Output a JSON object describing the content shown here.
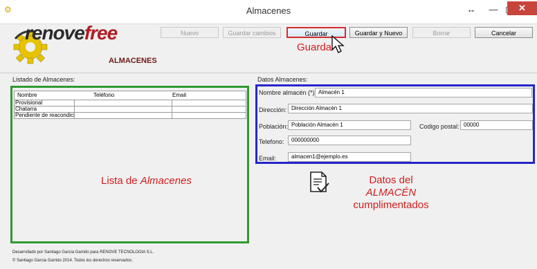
{
  "window": {
    "title": "Almacenes",
    "icon": "gear-icon",
    "controls": [
      "↔",
      "—",
      "▢",
      "✕"
    ]
  },
  "toolbar": {
    "nuevo": "Nuevo",
    "guardar_cambios": "Guardar cambios",
    "guardar": "Guardar",
    "guardar_y_nuevo": "Guardar y Nuevo",
    "borrar": "Borrar",
    "cancelar": "Cancelar"
  },
  "logo": {
    "text_a": "renove",
    "text_b": "free"
  },
  "section_title": "ALMACENES",
  "list": {
    "label": "Listado de Almacenes:",
    "columns": [
      "Nombre",
      "Teléfono",
      "Email"
    ],
    "rows": [
      [
        "Provisional",
        "",
        ""
      ],
      [
        "Chatarra",
        "",
        ""
      ],
      [
        "Pendiente de reacondiciona...",
        "",
        ""
      ]
    ]
  },
  "details": {
    "label": "Datos Almacenes:",
    "nombre_label": "Nombre almacén (*):",
    "nombre_value": "Almacén 1",
    "direccion_label": "Dirección:",
    "direccion_value": "Dirección Almacén 1",
    "poblacion_label": "Población:",
    "poblacion_value": "Población Almacén 1",
    "cp_label": "Codigo postal:",
    "cp_value": "00000",
    "telefono_label": "Telefono:",
    "telefono_value": "000000000",
    "email_label": "Email:",
    "email_value": "almacen1@ejemplo.es"
  },
  "annotations": {
    "guardar": "Guardar",
    "lista_prefix": "Lista de ",
    "lista_em": "Almacenes",
    "datos_prefix": "Datos del ",
    "datos_em": "ALMACÉN",
    "datos_line2": "cumplimentados"
  },
  "footer": {
    "line1": "Desarrollado por Santiago Garcia Garrido para RENOVE TECNOLOGIA S.L.",
    "line2": "© Santiago Garcia Garrido 2014. Todos los derechos reservados."
  }
}
